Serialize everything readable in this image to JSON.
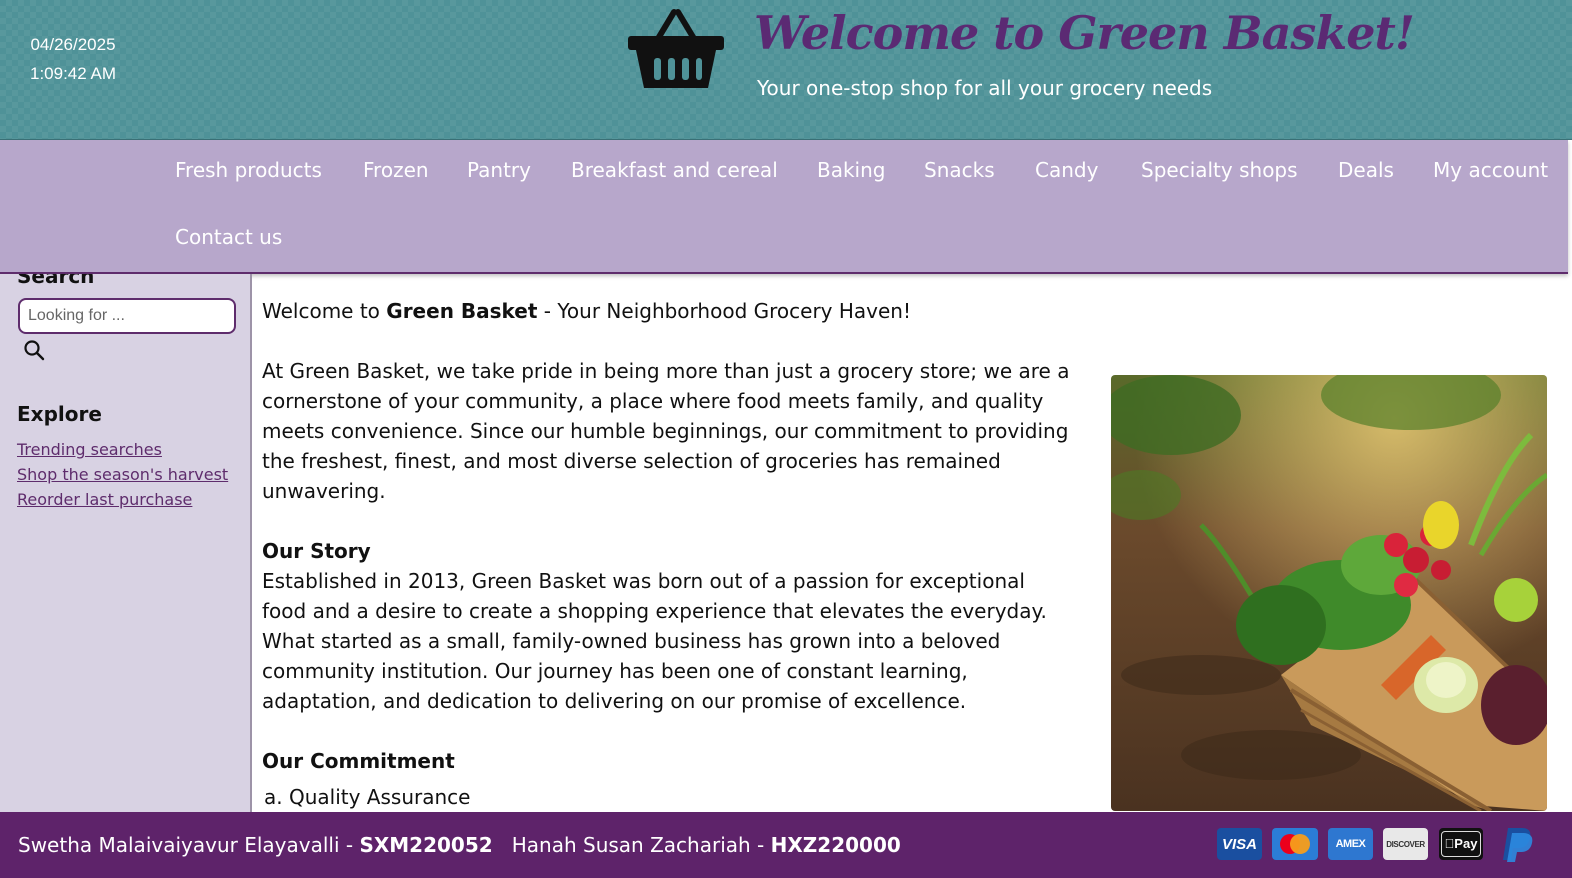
{
  "header": {
    "date": "04/26/2025",
    "time": "1:09:42 AM",
    "title": "Welcome to Green Basket!",
    "tagline": "Your one-stop shop for all your grocery needs",
    "logo_icon": "shopping-basket-icon"
  },
  "nav": {
    "items": [
      {
        "label": "Fresh products"
      },
      {
        "label": "Frozen"
      },
      {
        "label": "Pantry"
      },
      {
        "label": "Breakfast and cereal"
      },
      {
        "label": "Baking"
      },
      {
        "label": "Snacks"
      },
      {
        "label": "Candy"
      },
      {
        "label": "Specialty shops"
      },
      {
        "label": "Deals"
      },
      {
        "label": "My account"
      },
      {
        "label": "Contact us"
      }
    ]
  },
  "sidebar": {
    "search_heading": "Search",
    "search_placeholder": "Looking for ...",
    "search_icon": "search-icon",
    "explore_heading": "Explore",
    "explore_links": [
      {
        "label": "Trending searches"
      },
      {
        "label": "Shop the season's harvest"
      },
      {
        "label": "Reorder last purchase"
      }
    ]
  },
  "main": {
    "intro_prefix": "Welcome to ",
    "intro_bold": "Green Basket",
    "intro_suffix": " - Your Neighborhood Grocery Haven!",
    "paragraph1": "At Green Basket, we take pride in being more than just a grocery store; we are a cornerstone of your community, a place where food meets family, and quality meets convenience. Since our humble beginnings, our commitment to providing the freshest, finest, and most diverse selection of groceries has remained unwavering.",
    "story_heading": "Our Story",
    "story_text": "Established in 2013, Green Basket was born out of a passion for exceptional food and a desire to create a shopping experience that elevates the everyday. What started as a small, family-owned business has grown into a beloved community institution. Our journey has been one of constant learning, adaptation, and dedication to delivering on our promise of excellence.",
    "commitment_heading": "Our Commitment",
    "commitment_item1": "a. Quality Assurance"
  },
  "footer": {
    "author1_name": "Swetha Malaivaiyavur Elayavalli - ",
    "author1_id": "SXM220052",
    "author2_name": "Hanah Susan Zachariah - ",
    "author2_id": "HXZ220000",
    "payment_icons": [
      "visa-icon",
      "mastercard-icon",
      "amex-icon",
      "discover-icon",
      "apple-pay-icon",
      "paypal-icon"
    ],
    "visa_text": "VISA",
    "amex_text": "AMEX",
    "discover_text": "DISCOVER",
    "applepay_text": "Pay"
  },
  "colors": {
    "header_bg": "#4f9298",
    "nav_bg": "#b7a7cb",
    "brand_purple": "#5e236a",
    "sidebar_bg": "#d8d2e3"
  }
}
